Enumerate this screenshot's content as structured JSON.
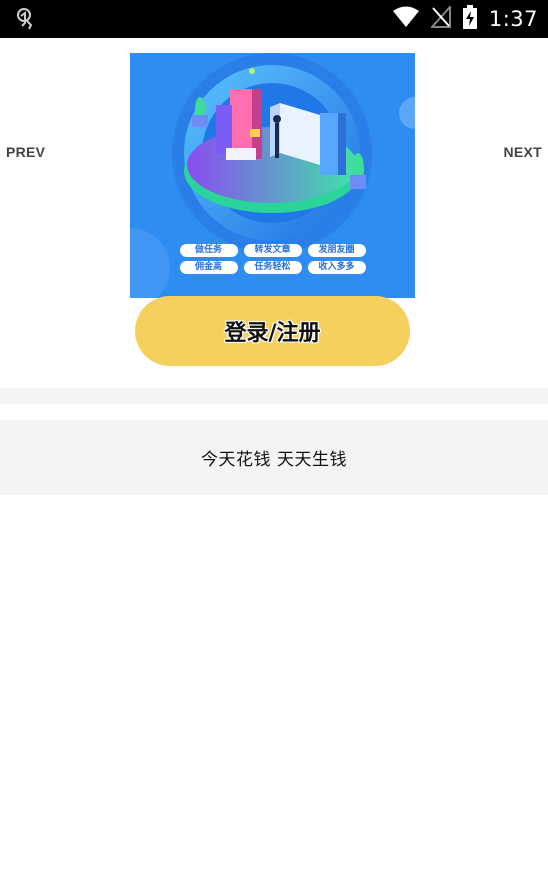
{
  "status_bar": {
    "time": "1:37",
    "icons": [
      "app-notification-icon",
      "wifi-icon",
      "no-signal-icon",
      "battery-charging-icon"
    ]
  },
  "carousel": {
    "prev_label": "PREV",
    "next_label": "NEXT",
    "banner": {
      "tags_row1": [
        "做任务",
        "转发文章",
        "发朋友圈"
      ],
      "tags_row2": [
        "佣金高",
        "任务轻松",
        "收入多多"
      ]
    }
  },
  "login_button": {
    "label": "登录/注册"
  },
  "slogan": {
    "text": "今天花钱 天天生钱"
  },
  "colors": {
    "banner_bg": "#2f8cf0",
    "button_bg": "#f6d05c",
    "section_bg": "#f4f4f4"
  }
}
